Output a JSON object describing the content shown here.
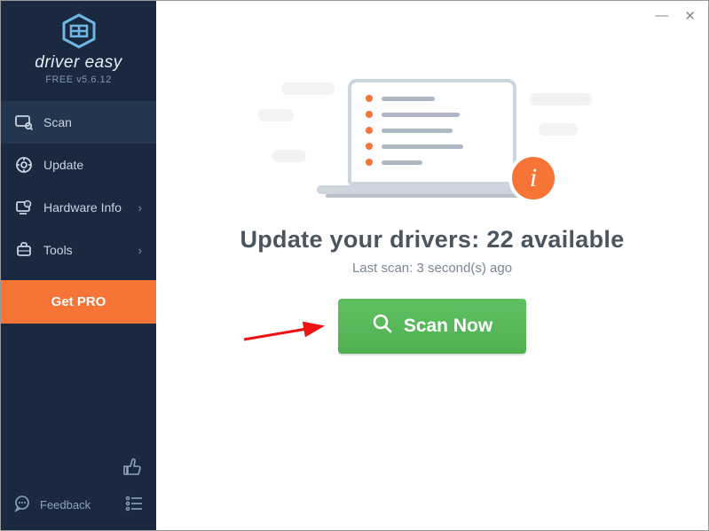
{
  "app": {
    "brand": "driver easy",
    "version_line": "FREE v5.6.12"
  },
  "sidebar": {
    "items": [
      {
        "label": "Scan",
        "has_chevron": false
      },
      {
        "label": "Update",
        "has_chevron": false
      },
      {
        "label": "Hardware Info",
        "has_chevron": true
      },
      {
        "label": "Tools",
        "has_chevron": true
      }
    ],
    "get_pro_label": "Get PRO",
    "feedback_label": "Feedback"
  },
  "main": {
    "headline": "Update your drivers: 22 available",
    "subline": "Last scan: 3 second(s) ago",
    "scan_button_label": "Scan Now"
  },
  "colors": {
    "sidebar_bg": "#1a2940",
    "accent_orange": "#f67436",
    "scan_green": "#53b956"
  }
}
